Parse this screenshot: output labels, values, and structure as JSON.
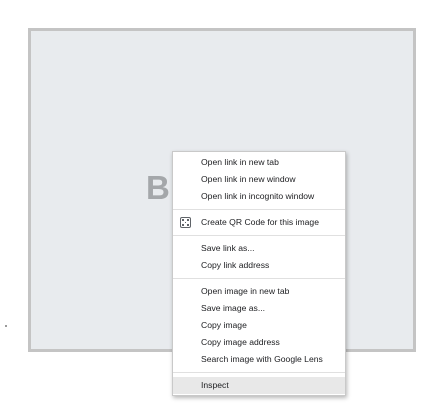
{
  "image": {
    "letter": "B"
  },
  "context_menu": {
    "group1": [
      {
        "label": "Open link in new tab"
      },
      {
        "label": "Open link in new window"
      },
      {
        "label": "Open link in incognito window"
      }
    ],
    "qr_item": {
      "label": "Create QR Code for this image",
      "icon": "qr-code-icon"
    },
    "group2": [
      {
        "label": "Save link as..."
      },
      {
        "label": "Copy link address"
      }
    ],
    "group3": [
      {
        "label": "Open image in new tab"
      },
      {
        "label": "Save image as..."
      },
      {
        "label": "Copy image"
      },
      {
        "label": "Copy image address"
      },
      {
        "label": "Search image with Google Lens"
      }
    ],
    "inspect": {
      "label": "Inspect",
      "hovered": true
    }
  }
}
